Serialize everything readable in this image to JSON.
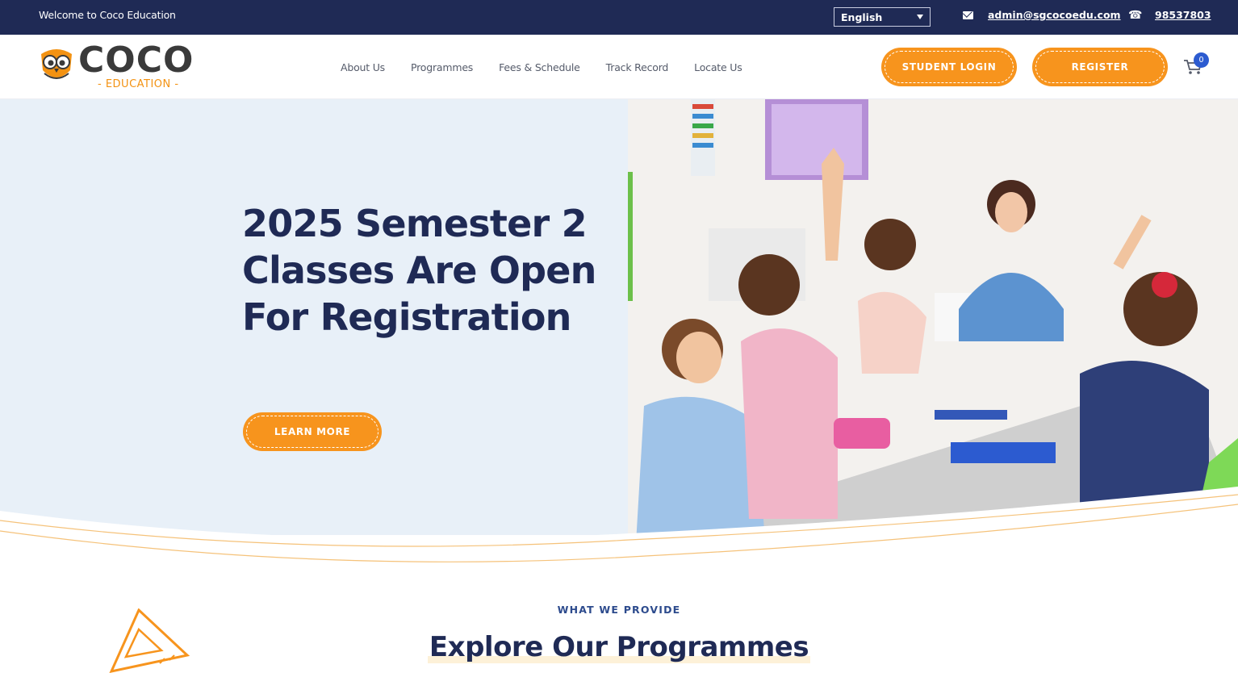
{
  "topbar": {
    "welcome": "Welcome to Coco Education",
    "language": "English",
    "email": "admin@sgcocoedu.com",
    "phone": "98537803"
  },
  "brand": {
    "name": "COCO",
    "sub": "EDUCATION"
  },
  "nav": [
    "About Us",
    "Programmes",
    "Fees & Schedule",
    "Track Record",
    "Locate Us"
  ],
  "actions": {
    "student_login": "STUDENT LOGIN",
    "register": "REGISTER",
    "cart_count": "0"
  },
  "hero": {
    "headline": "2025 Semester 2 Classes Are Open For Registration",
    "cta": "LEARN MORE",
    "photo_alt_icon": "classroom-photo"
  },
  "section": {
    "eyebrow": "WHAT WE PROVIDE",
    "title": "Explore Our Programmes"
  },
  "colors": {
    "navy": "#1f2a55",
    "orange": "#f7941d",
    "hero_bg": "#e8f0f8",
    "badge_blue": "#2c5bd0"
  }
}
